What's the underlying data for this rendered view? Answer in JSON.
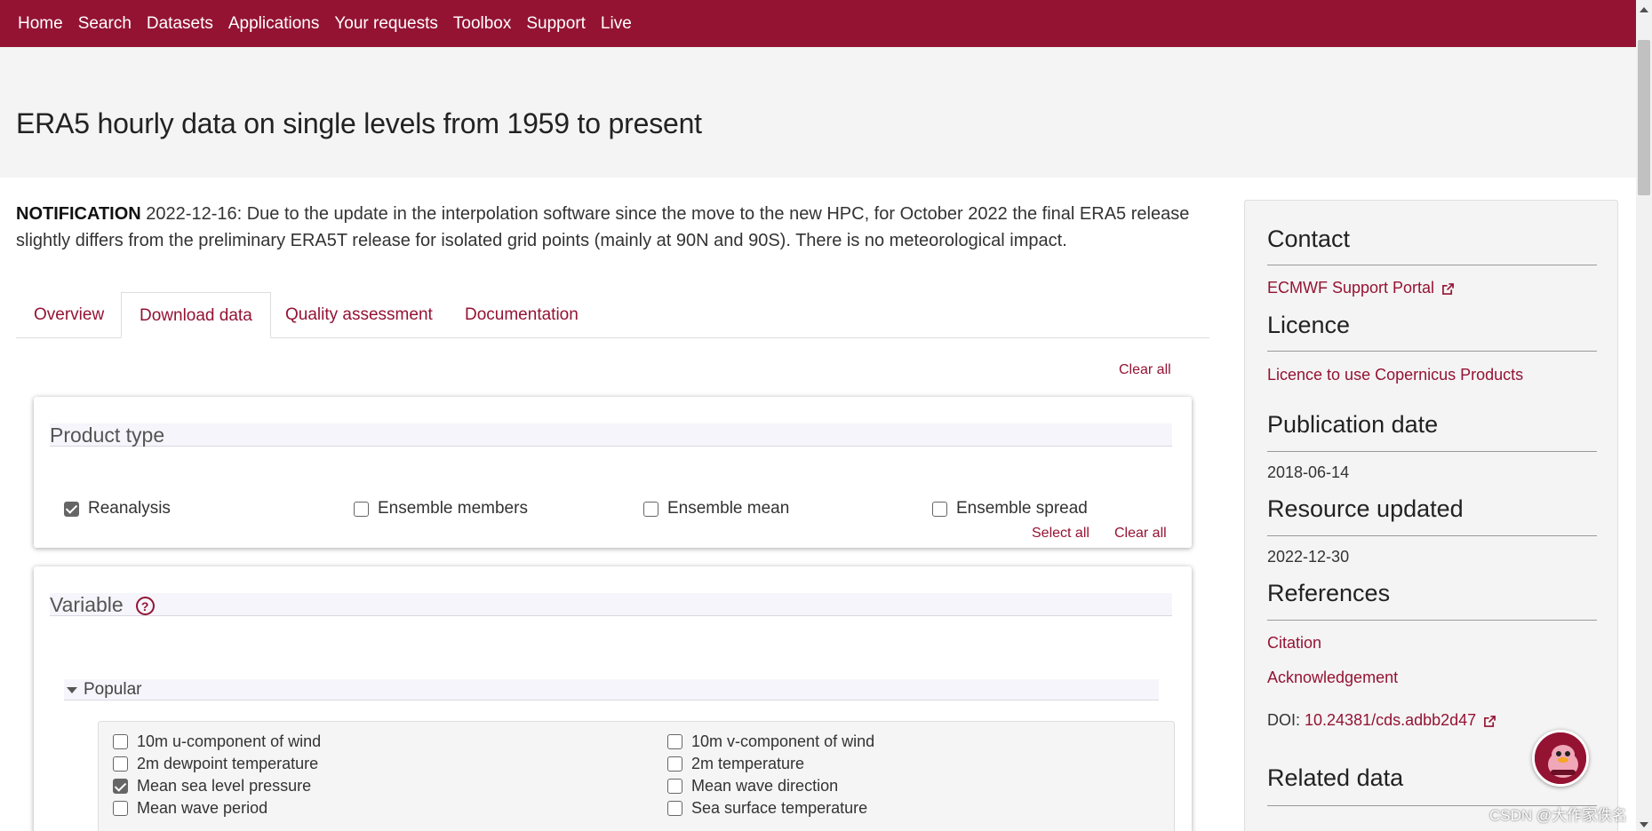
{
  "nav": {
    "items": [
      "Home",
      "Search",
      "Datasets",
      "Applications",
      "Your requests",
      "Toolbox",
      "Support",
      "Live"
    ]
  },
  "page": {
    "title": "ERA5 hourly data on single levels from 1959 to present"
  },
  "notification": {
    "label": "NOTIFICATION",
    "text": " 2022-12-16: Due to the update in the interpolation software since the move to the new HPC, for October 2022 the final ERA5 release slightly differs from the preliminary ERA5T release for isolated grid points (mainly at 90N and 90S). There is no meteorological impact."
  },
  "tabs": [
    {
      "label": "Overview",
      "active": false
    },
    {
      "label": "Download data",
      "active": true
    },
    {
      "label": "Quality assessment",
      "active": false
    },
    {
      "label": "Documentation",
      "active": false
    }
  ],
  "form": {
    "clear_all_top": "Clear all",
    "product_type": {
      "title": "Product type",
      "options": [
        {
          "label": "Reanalysis",
          "checked": true
        },
        {
          "label": "Ensemble members",
          "checked": false
        },
        {
          "label": "Ensemble mean",
          "checked": false
        },
        {
          "label": "Ensemble spread",
          "checked": false
        }
      ],
      "select_all": "Select all",
      "clear_all": "Clear all"
    },
    "variable": {
      "title": "Variable",
      "help_icon": "?",
      "popular_label": "Popular",
      "options": [
        {
          "label": "10m u-component of wind",
          "checked": false
        },
        {
          "label": "10m v-component of wind",
          "checked": false
        },
        {
          "label": "2m dewpoint temperature",
          "checked": false
        },
        {
          "label": "2m temperature",
          "checked": false
        },
        {
          "label": "Mean sea level pressure",
          "checked": true
        },
        {
          "label": "Mean wave direction",
          "checked": false
        },
        {
          "label": "Mean wave period",
          "checked": false
        },
        {
          "label": "Sea surface temperature",
          "checked": false
        }
      ]
    }
  },
  "sidebar": {
    "contact_title": "Contact",
    "contact_link": "ECMWF Support Portal",
    "licence_title": "Licence",
    "licence_link": "Licence to use Copernicus Products",
    "publication_title": "Publication date",
    "publication_date": "2018-06-14",
    "updated_title": "Resource updated",
    "updated_date": "2022-12-30",
    "references_title": "References",
    "citation": "Citation",
    "acknowledgement": "Acknowledgement",
    "doi_label": "DOI: ",
    "doi_value": "10.24381/cds.adbb2d47",
    "related_title": "Related data"
  },
  "watermark": "CSDN @大作家佚名",
  "colors": {
    "brand": "#941333",
    "hero_bg": "#f4f4f4"
  }
}
